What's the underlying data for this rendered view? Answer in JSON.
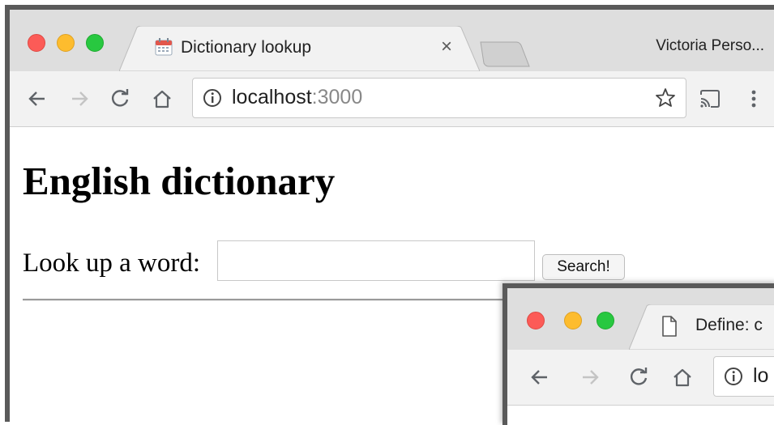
{
  "main_window": {
    "tab": {
      "title": "Dictionary lookup",
      "icon": "calendar-icon",
      "close": "×"
    },
    "profile": "Victoria Perso...",
    "address": {
      "host": "localhost",
      "port": ":3000"
    },
    "page": {
      "heading": "English dictionary",
      "lookup_label": "Look up a word:",
      "input_value": "",
      "search_button": "Search!"
    }
  },
  "second_window": {
    "tab": {
      "title": "Define: c",
      "icon": "document-icon"
    },
    "address": {
      "host": "lo"
    }
  },
  "colors": {
    "tabstrip": "#dedede",
    "toolbar": "#f2f2f2",
    "frame": "#5a5a5a",
    "close": "#fc5b57",
    "minimize": "#fdbc2e",
    "zoom": "#28c840"
  }
}
